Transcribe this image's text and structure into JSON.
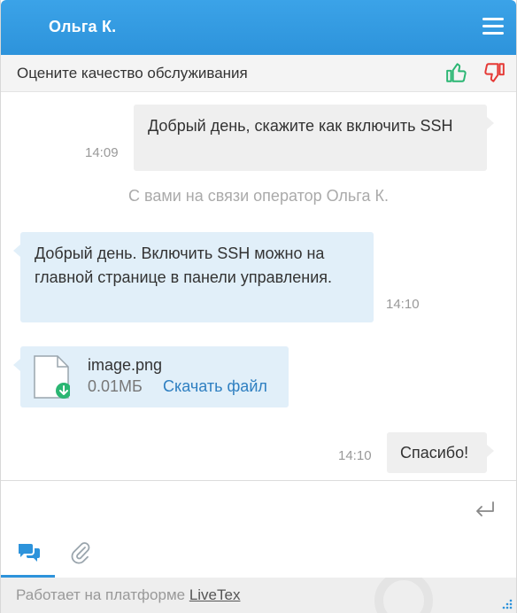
{
  "header": {
    "operator_name": "Ольга К."
  },
  "rating": {
    "prompt": "Оцените качество обслуживания"
  },
  "messages": {
    "m1": {
      "text": "Добрый день, скажите как включить SSH",
      "time": "14:09"
    },
    "system": "С вами на связи оператор Ольга К.",
    "m2": {
      "text": "Добрый день. Включить SSH можно на главной странице в панели управления.",
      "time": "14:10"
    },
    "file": {
      "name": "image.png",
      "size": "0.01МБ",
      "download_label": "Скачать файл"
    },
    "m3": {
      "text": "Спасибо!",
      "time": "14:10"
    }
  },
  "input": {
    "value": ""
  },
  "footer": {
    "text": "Работает на платформе ",
    "link": "LiveTex"
  },
  "colors": {
    "accent": "#2d93db",
    "thumb_up": "#2bb673",
    "thumb_down": "#e53935",
    "operator_bubble": "#e1eff9",
    "client_bubble": "#efefef"
  }
}
